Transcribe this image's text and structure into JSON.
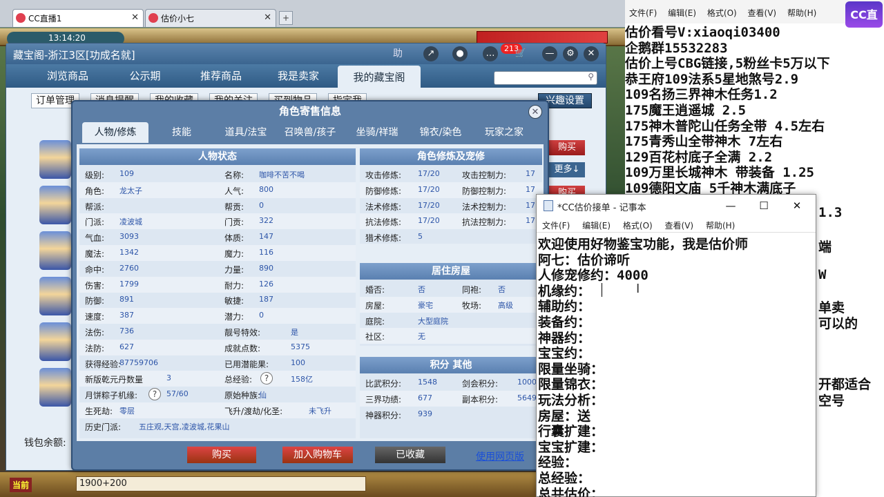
{
  "browser": {
    "tabs": [
      {
        "label": "CC直播1"
      },
      {
        "label": "估价小七"
      }
    ],
    "add": "+"
  },
  "game": {
    "time": "13:14:20",
    "current": "当前",
    "chat_input": "1900+200"
  },
  "cbg": {
    "title": "藏宝阁-浙江3区[功成名就]",
    "help": "助",
    "badge": "213",
    "nav": [
      "浏览商品",
      "公示期",
      "推荐商品",
      "我是卖家",
      "我的藏宝阁"
    ],
    "subnav": [
      "订单管理",
      "消息提醒",
      "我的收藏",
      "我的关注",
      "买到物品",
      "指定我"
    ],
    "interest": "兴趣设置",
    "side_buttons": [
      "购买",
      "更多↓",
      "购买"
    ],
    "wallet": "钱包余额:"
  },
  "dialog": {
    "title": "角色寄售信息",
    "tabs": [
      "人物/修炼",
      "技能",
      "道具/法宝",
      "召唤兽/孩子",
      "坐骑/祥瑞",
      "锦衣/染色",
      "玩家之家"
    ],
    "status_head": "人物状态",
    "left_col": [
      {
        "k": "级别:",
        "v": "109"
      },
      {
        "k": "角色:",
        "v": "龙太子"
      },
      {
        "k": "帮派:",
        "v": ""
      },
      {
        "k": "门派:",
        "v": "凌波城"
      },
      {
        "k": "气血:",
        "v": "3093"
      },
      {
        "k": "魔法:",
        "v": "1342"
      },
      {
        "k": "命中:",
        "v": "2760"
      },
      {
        "k": "伤害:",
        "v": "1799"
      },
      {
        "k": "防御:",
        "v": "891"
      },
      {
        "k": "速度:",
        "v": "387"
      },
      {
        "k": "法伤:",
        "v": "736"
      },
      {
        "k": "法防:",
        "v": "627"
      },
      {
        "k": "获得经验:",
        "v": "87759706"
      },
      {
        "k": "新版乾元丹数量",
        "v": "3"
      },
      {
        "k": "月饼粽子机缘:",
        "v": "57/60"
      },
      {
        "k": "生死劫:",
        "v": "零层"
      }
    ],
    "right_col": [
      {
        "k": "名称:",
        "v": "咖啡不苦不喝"
      },
      {
        "k": "人气:",
        "v": "800"
      },
      {
        "k": "帮贡:",
        "v": "0"
      },
      {
        "k": "门贡:",
        "v": "322"
      },
      {
        "k": "体质:",
        "v": "147"
      },
      {
        "k": "魔力:",
        "v": "116"
      },
      {
        "k": "力量:",
        "v": "890"
      },
      {
        "k": "耐力:",
        "v": "126"
      },
      {
        "k": "敏捷:",
        "v": "187"
      },
      {
        "k": "潜力:",
        "v": "0"
      },
      {
        "k": "靓号特效:",
        "v": "是"
      },
      {
        "k": "成就点数:",
        "v": "5375"
      },
      {
        "k": "已用潜能果:",
        "v": "100"
      },
      {
        "k": "总经验:",
        "v": "158亿"
      },
      {
        "k": "原始种族:",
        "v": "仙"
      },
      {
        "k": "飞升/渡劫/化圣:",
        "v": "未飞升"
      }
    ],
    "history": {
      "k": "历史门派:",
      "v": "五庄观,天宫,凌波城,花果山"
    },
    "xiulian_head": "角色修炼及宠修",
    "xiulian": [
      {
        "k": "攻击修炼:",
        "v": "17/20",
        "k2": "攻击控制力:",
        "v2": "17"
      },
      {
        "k": "防御修炼:",
        "v": "17/20",
        "k2": "防御控制力:",
        "v2": "17"
      },
      {
        "k": "法术修炼:",
        "v": "17/20",
        "k2": "法术控制力:",
        "v2": "17"
      },
      {
        "k": "抗法修炼:",
        "v": "17/20",
        "k2": "抗法控制力:",
        "v2": "17"
      },
      {
        "k": "猎术修炼:",
        "v": "5",
        "k2": "",
        "v2": ""
      }
    ],
    "house_head": "居住房屋",
    "house": [
      {
        "k": "婚否:",
        "v": "否",
        "k2": "同袍:",
        "v2": "否"
      },
      {
        "k": "房屋:",
        "v": "豪宅",
        "k2": "牧场:",
        "v2": "高级"
      },
      {
        "k": "庭院:",
        "v": "大型庭院",
        "k2": "",
        "v2": ""
      },
      {
        "k": "社区:",
        "v": "无",
        "k2": "",
        "v2": ""
      }
    ],
    "score_head": "积分 其他",
    "scores": [
      {
        "k": "比武积分:",
        "v": "1548",
        "k2": "剑会积分:",
        "v2": "1000"
      },
      {
        "k": "三界功绩:",
        "v": "677",
        "k2": "副本积分:",
        "v2": "5649"
      },
      {
        "k": "神器积分:",
        "v": "939",
        "k2": "",
        "v2": ""
      }
    ],
    "buttons": {
      "buy": "购买",
      "cart": "加入购物车",
      "fav": "已收藏",
      "web": "使用网页版"
    }
  },
  "right_notepad": {
    "menu": [
      "文件(F)",
      "编辑(E)",
      "格式(O)",
      "查看(V)",
      "帮助(H)"
    ],
    "lines": [
      "估价看号V:xiaoqi03400",
      "企鹅群15532283",
      "估价上号CBG链接,5粉丝卡5万以下",
      "恭王府109法系5星地煞号2.9",
      "109名扬三界神木任务1.2",
      "175魔王逍遥城 2.5",
      "175神木普陀山任务全带 4.5左右",
      "175青秀山全带神木  7左右",
      "129百花村底子全满 2.2",
      "109万里长城神木 带装备  1.25",
      "109德阳文庙 5千神木满底子"
    ],
    "tail_lines": [
      "1.3",
      "端",
      "W",
      "单卖",
      "可以的",
      "开都适合",
      "空号"
    ],
    "cc_logo": "CC直播"
  },
  "notepad": {
    "title": "*CC估价接单 - 记事本",
    "menu": [
      "文件(F)",
      "编辑(E)",
      "格式(O)",
      "查看(V)",
      "帮助(H)"
    ],
    "lines": [
      "欢迎使用好物鉴宝功能，我是估价师",
      "阿七：估价谛听",
      "人修宠修约：4000",
      "机缘约：",
      "辅助约：",
      "装备约：",
      "神器约：",
      "宝宝约：",
      "限量坐骑：",
      "限量锦衣：",
      "玩法分析：",
      "房屋：送",
      "行囊扩建：",
      "宝宝扩建：",
      "经验：",
      "总经验：",
      "总共估价："
    ]
  }
}
